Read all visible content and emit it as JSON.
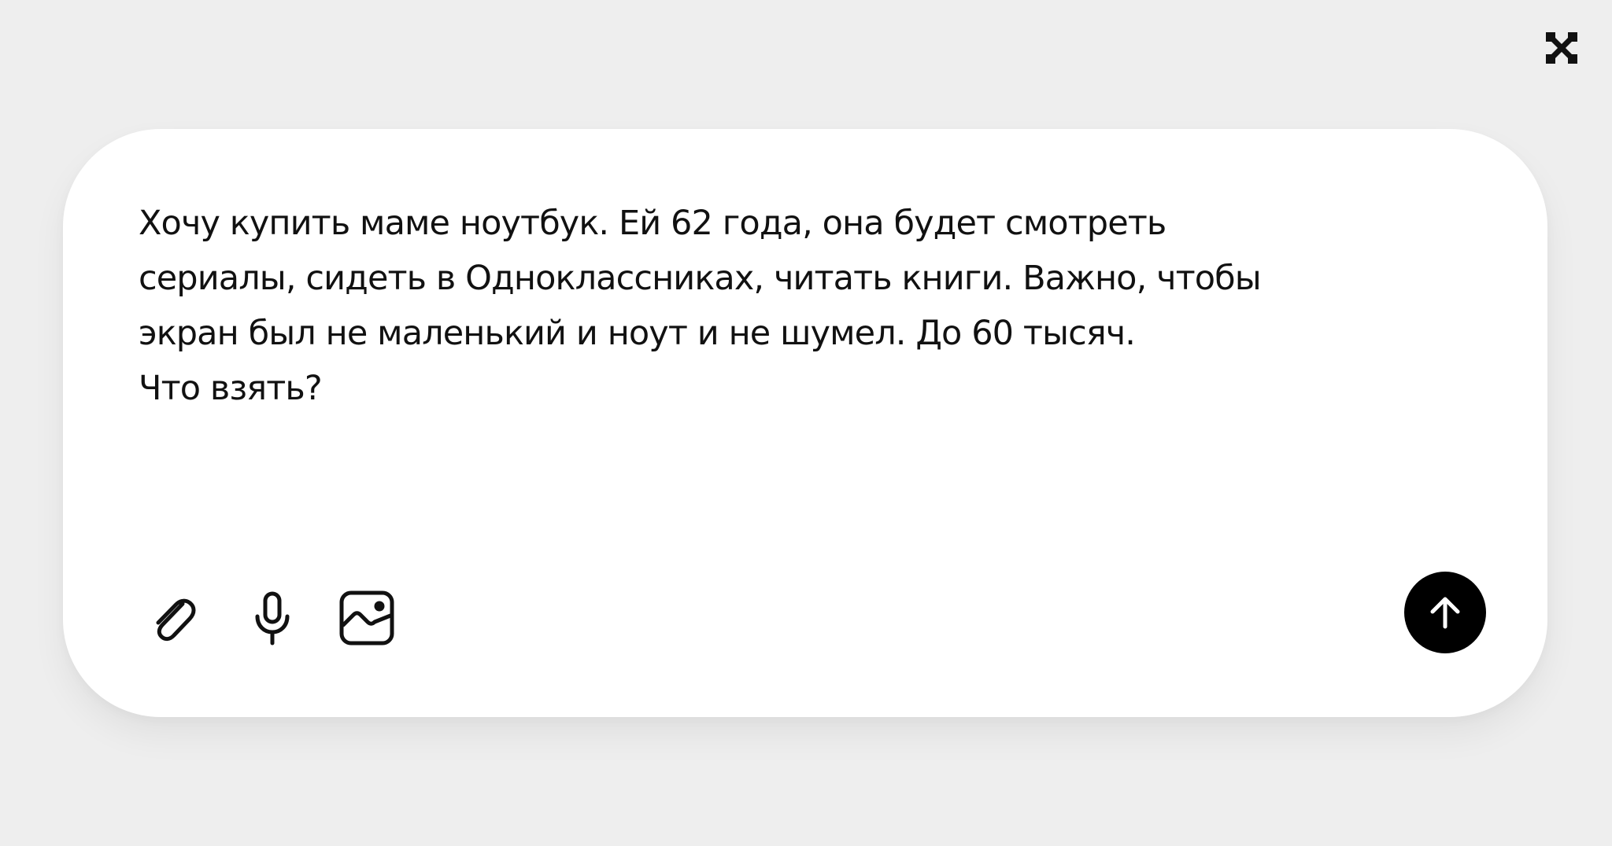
{
  "app": {
    "logo_icon": "close-x-logo-icon"
  },
  "composer": {
    "text": "Хочу купить маме ноутбук. Ей 62 года, она будет смотреть\nсериалы, сидеть в Одноклассниках, читать книги. Важно, чтобы\nэкран был не маленький и ноут и не шумел. До 60 тысяч.\nЧто взять?",
    "tools": [
      {
        "name": "attach",
        "icon": "paperclip-icon"
      },
      {
        "name": "voice",
        "icon": "microphone-icon"
      },
      {
        "name": "image",
        "icon": "image-icon"
      }
    ],
    "send": {
      "icon": "arrow-up-icon"
    }
  },
  "colors": {
    "background": "#eeeeee",
    "card": "#ffffff",
    "text": "#111111",
    "send_button": "#000000",
    "icon_stroke": "#111111"
  }
}
